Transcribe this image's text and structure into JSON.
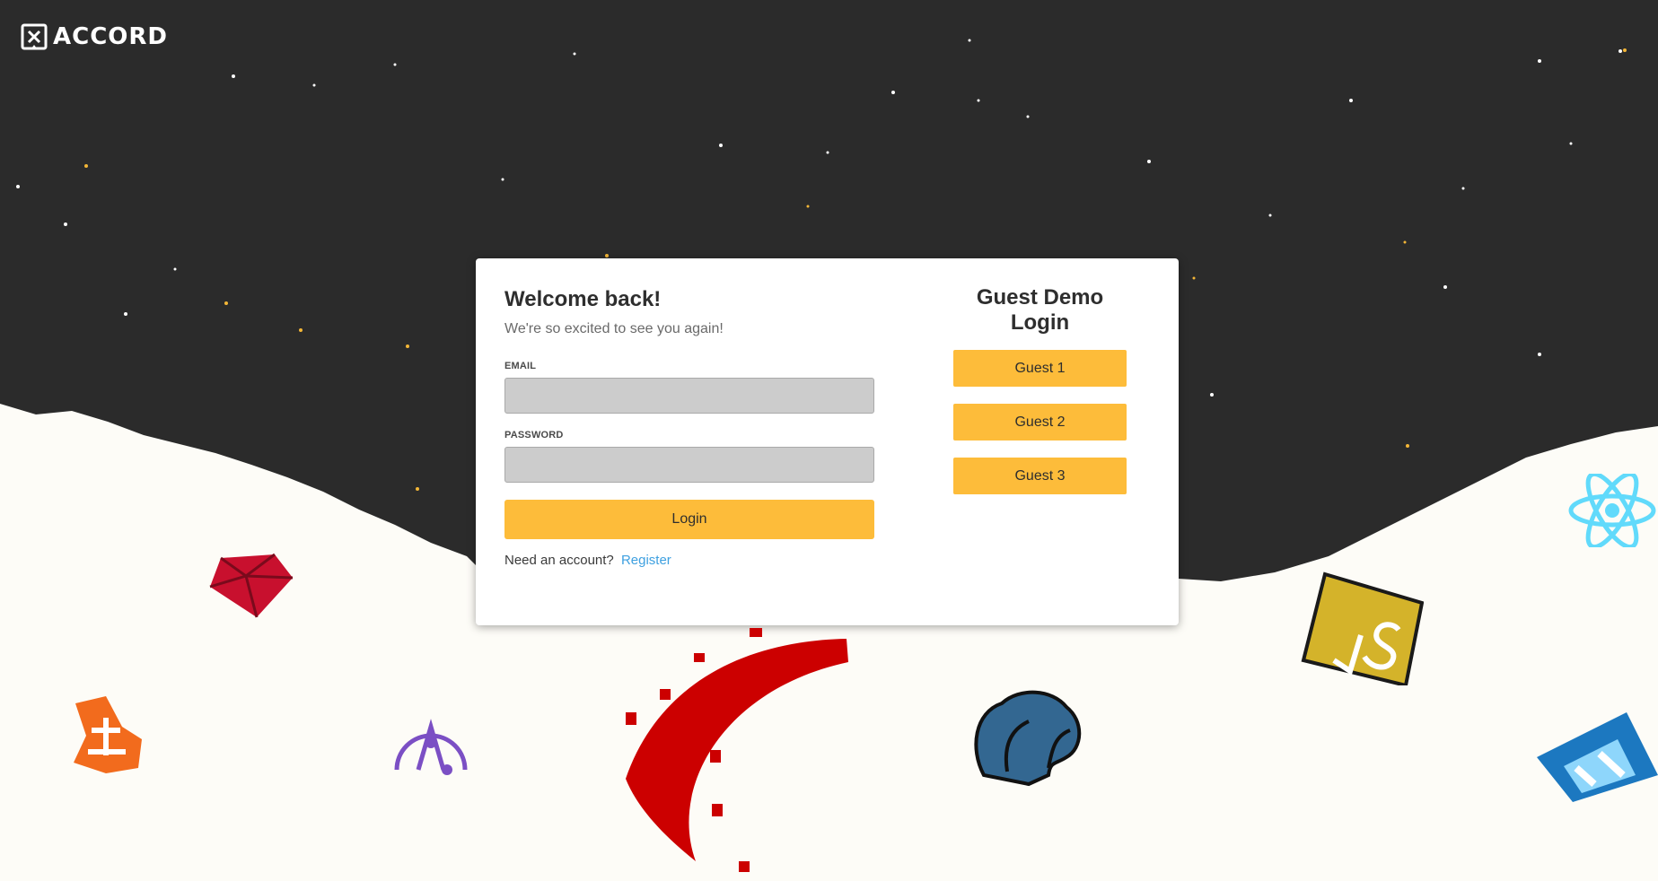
{
  "brand": {
    "name": "ACCORD"
  },
  "login": {
    "title": "Welcome back!",
    "subtitle": "We're so excited to see you again!",
    "email_label": "EMAIL",
    "email_value": "",
    "password_label": "PASSWORD",
    "password_value": "",
    "button_label": "Login",
    "register_prompt": "Need an account?",
    "register_link": "Register"
  },
  "guest": {
    "title": "Guest Demo Login",
    "buttons": [
      "Guest 1",
      "Guest 2",
      "Guest 3"
    ]
  },
  "colors": {
    "accent": "#fdbc3a",
    "link": "#3ea0e0",
    "night": "#2b2b2b",
    "snow": "#fdfcf7"
  },
  "decorations": [
    "ruby-icon",
    "ember-icon",
    "apollo-icon",
    "rails-icon",
    "postgres-icon",
    "javascript-icon",
    "react-icon",
    "webpack-icon"
  ]
}
